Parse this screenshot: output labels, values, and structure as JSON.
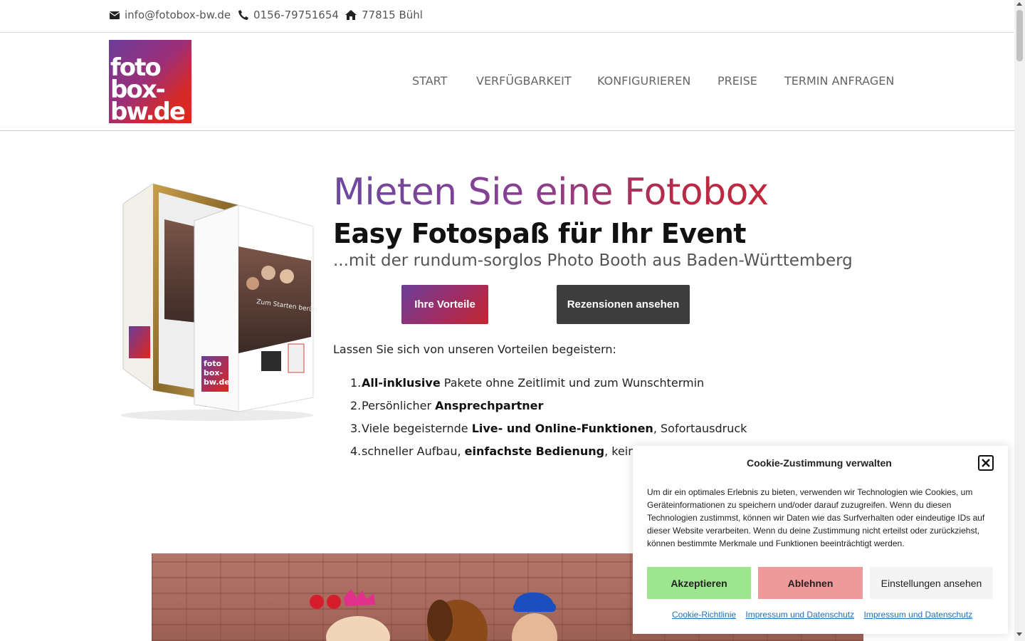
{
  "topbar": {
    "email": "info@fotobox-bw.de",
    "phone": "0156-79751654",
    "address": "77815 Bühl",
    "icons": [
      "envelope-icon",
      "phone-icon",
      "home-icon"
    ]
  },
  "logo": {
    "lines": [
      "foto",
      "box-",
      "bw.de"
    ]
  },
  "nav": {
    "items": [
      {
        "label": "START"
      },
      {
        "label": "VERFÜGBARKEIT"
      },
      {
        "label": "KONFIGURIEREN"
      },
      {
        "label": "PREISE"
      },
      {
        "label": "TERMIN ANFRAGEN"
      }
    ]
  },
  "hero": {
    "title": "Mieten Sie eine Fotobox",
    "subtitle": "Easy Fotospaß für Ihr Event",
    "tagline": "...mit der rundum-sorglos Photo Booth aus Baden-Württemberg",
    "button_primary": "Ihre Vorteile",
    "button_secondary": "Rezensionen ansehen",
    "intro": "Lassen Sie sich von unseren Vorteilen begeistern:",
    "benefits": [
      {
        "num": "1.",
        "bold": "All-inklusive",
        "rest": " Pakete ohne Zeitlimit und zum Wunschtermin",
        "pre": ""
      },
      {
        "num": "2.",
        "pre": "Persönlicher ",
        "bold": "Ansprechpartner",
        "rest": ""
      },
      {
        "num": "3.",
        "pre": "Viele begeisternde ",
        "bold": "Live- und Online-Funktionen",
        "rest": ", Sofortausdruck"
      },
      {
        "num": "4.",
        "pre": "schneller Aufbau, ",
        "bold": "einfachste Bedienung",
        "rest": ",  keine Betreuung notwendig"
      }
    ],
    "booth_brand": [
      "foto",
      "box-",
      "bw.de"
    ],
    "booth_screen_text": "Zum Starten berühren"
  },
  "cookie": {
    "title": "Cookie-Zustimmung verwalten",
    "text": "Um dir ein optimales Erlebnis zu bieten, verwenden wir Technologien wie Cookies, um Geräteinformationen zu speichern und/oder darauf zuzugreifen. Wenn du diesen Technologien zustimmst, können wir Daten wie das Surfverhalten oder eindeutige IDs auf dieser Website verarbeiten. Wenn du deine Zustimmung nicht erteilst oder zurückziehst, können bestimmte Merkmale und Funktionen beeinträchtigt werden.",
    "accept": "Akzeptieren",
    "deny": "Ablehnen",
    "settings": "Einstellungen ansehen",
    "links": [
      "Cookie-Richtlinie",
      "Impressum und Datenschutz",
      "Impressum und Datenschutz"
    ]
  },
  "colors": {
    "brand_purple": "#6c4aa0",
    "brand_red": "#c2283a",
    "accept_green": "#9ee58f",
    "deny_red": "#ee9a9a",
    "dark_button": "#3d3d3d"
  }
}
